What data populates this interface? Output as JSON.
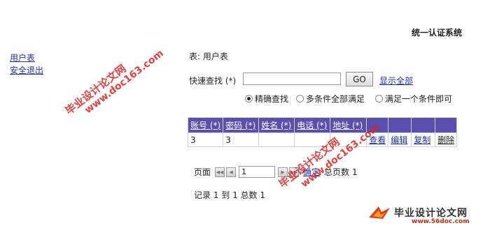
{
  "header": {
    "system_title": "统一认证系统"
  },
  "sidebar": {
    "items": [
      {
        "label": "用户表"
      },
      {
        "label": "安全退出"
      }
    ]
  },
  "main": {
    "table_title": "表: 用户表",
    "search": {
      "label": "快速查找 (*)",
      "value": "",
      "placeholder": "",
      "go_label": "GO",
      "show_all_label": "显示全部"
    },
    "match_modes": [
      {
        "label": "精确查找",
        "selected": true
      },
      {
        "label": "多条件全部满足",
        "selected": false
      },
      {
        "label": "满足一个条件即可",
        "selected": false
      }
    ],
    "table": {
      "columns": [
        "账号 (*)",
        "密码 (*)",
        "姓名 (*)",
        "电话 (*)",
        "地址 (*)"
      ],
      "rows": [
        {
          "cells": [
            "3",
            "3",
            "",
            "",
            ""
          ],
          "actions": [
            "查看",
            "编辑",
            "复制",
            "删除"
          ]
        }
      ]
    },
    "pager": {
      "page_label": "页面",
      "page_value": "1",
      "go_label": "确定",
      "total_pages_label": "总页数",
      "total_pages": "1"
    },
    "record_info": "记录 1 到 1 总数 1"
  },
  "watermarks": {
    "site_name": "毕业设计论文网",
    "site_url": "www.doc163.com",
    "logo_url": "www.56doc.com"
  },
  "colors": {
    "header_bg": "#5a4fae",
    "link": "#2233aa",
    "watermark": "#e02020"
  }
}
